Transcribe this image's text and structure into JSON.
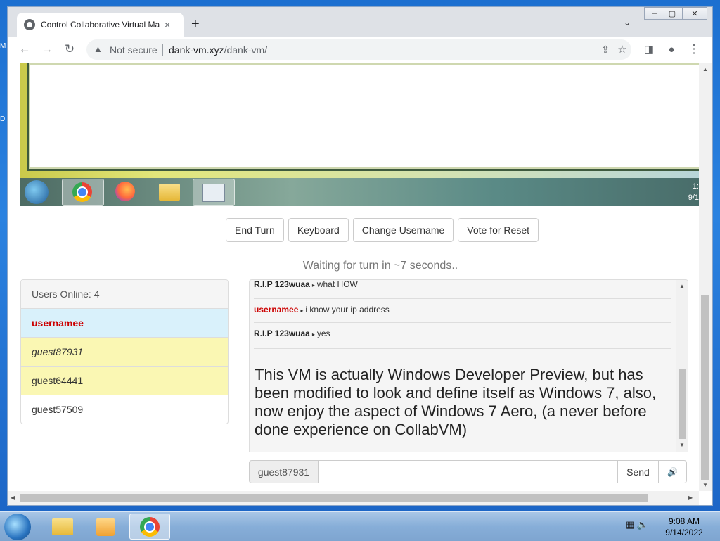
{
  "desktop": {
    "edge_letters": [
      "M",
      "D"
    ]
  },
  "browser": {
    "tab_title": "Control Collaborative Virtual Ma",
    "tab_close": "×",
    "new_tab": "+",
    "tab_search": "⌄",
    "win_controls": [
      "–",
      "▢",
      "✕"
    ],
    "nav": {
      "back": "←",
      "forward": "→",
      "reload": "↻"
    },
    "security_label": "Not secure",
    "url_host": "dank-vm.xyz",
    "url_path": "/dank-vm/",
    "toolbar_icons": [
      "share-icon",
      "star-icon",
      "side-panel-icon",
      "profile-icon",
      "more-icon"
    ]
  },
  "vm": {
    "taskbar_apps": [
      "windows-orb",
      "chrome",
      "firefox",
      "explorer",
      "monitor"
    ],
    "clock_lines": [
      "1:",
      "9/1"
    ]
  },
  "controls": {
    "end_turn": "End Turn",
    "keyboard": "Keyboard",
    "change_username": "Change Username",
    "vote_reset": "Vote for Reset"
  },
  "status": "Waiting for turn in ~7 seconds..",
  "users": {
    "header": "Users Online: 4",
    "list": [
      {
        "name": "usernamee"
      },
      {
        "name": "guest87931"
      },
      {
        "name": "guest64441"
      },
      {
        "name": "guest57509"
      }
    ]
  },
  "chat": {
    "messages": [
      {
        "user": "R.I.P 123wuaa",
        "text": "what HOW"
      },
      {
        "user": "usernamee",
        "text": "i know your ip address"
      },
      {
        "user": "R.I.P 123wuaa",
        "text": "yes"
      }
    ],
    "announcement": "This VM is actually Windows Developer Preview, but has been modified to look and define itself as Windows 7, also, now enjoy the aspect of Windows 7 Aero, (a never before done experience on CollabVM)",
    "input_username": "guest87931",
    "input_value": "",
    "send_label": "Send",
    "volume_icon": "🔊"
  },
  "taskbar": {
    "apps": [
      "explorer",
      "media-player",
      "chrome"
    ],
    "time": "9:08 AM",
    "date": "9/14/2022"
  }
}
